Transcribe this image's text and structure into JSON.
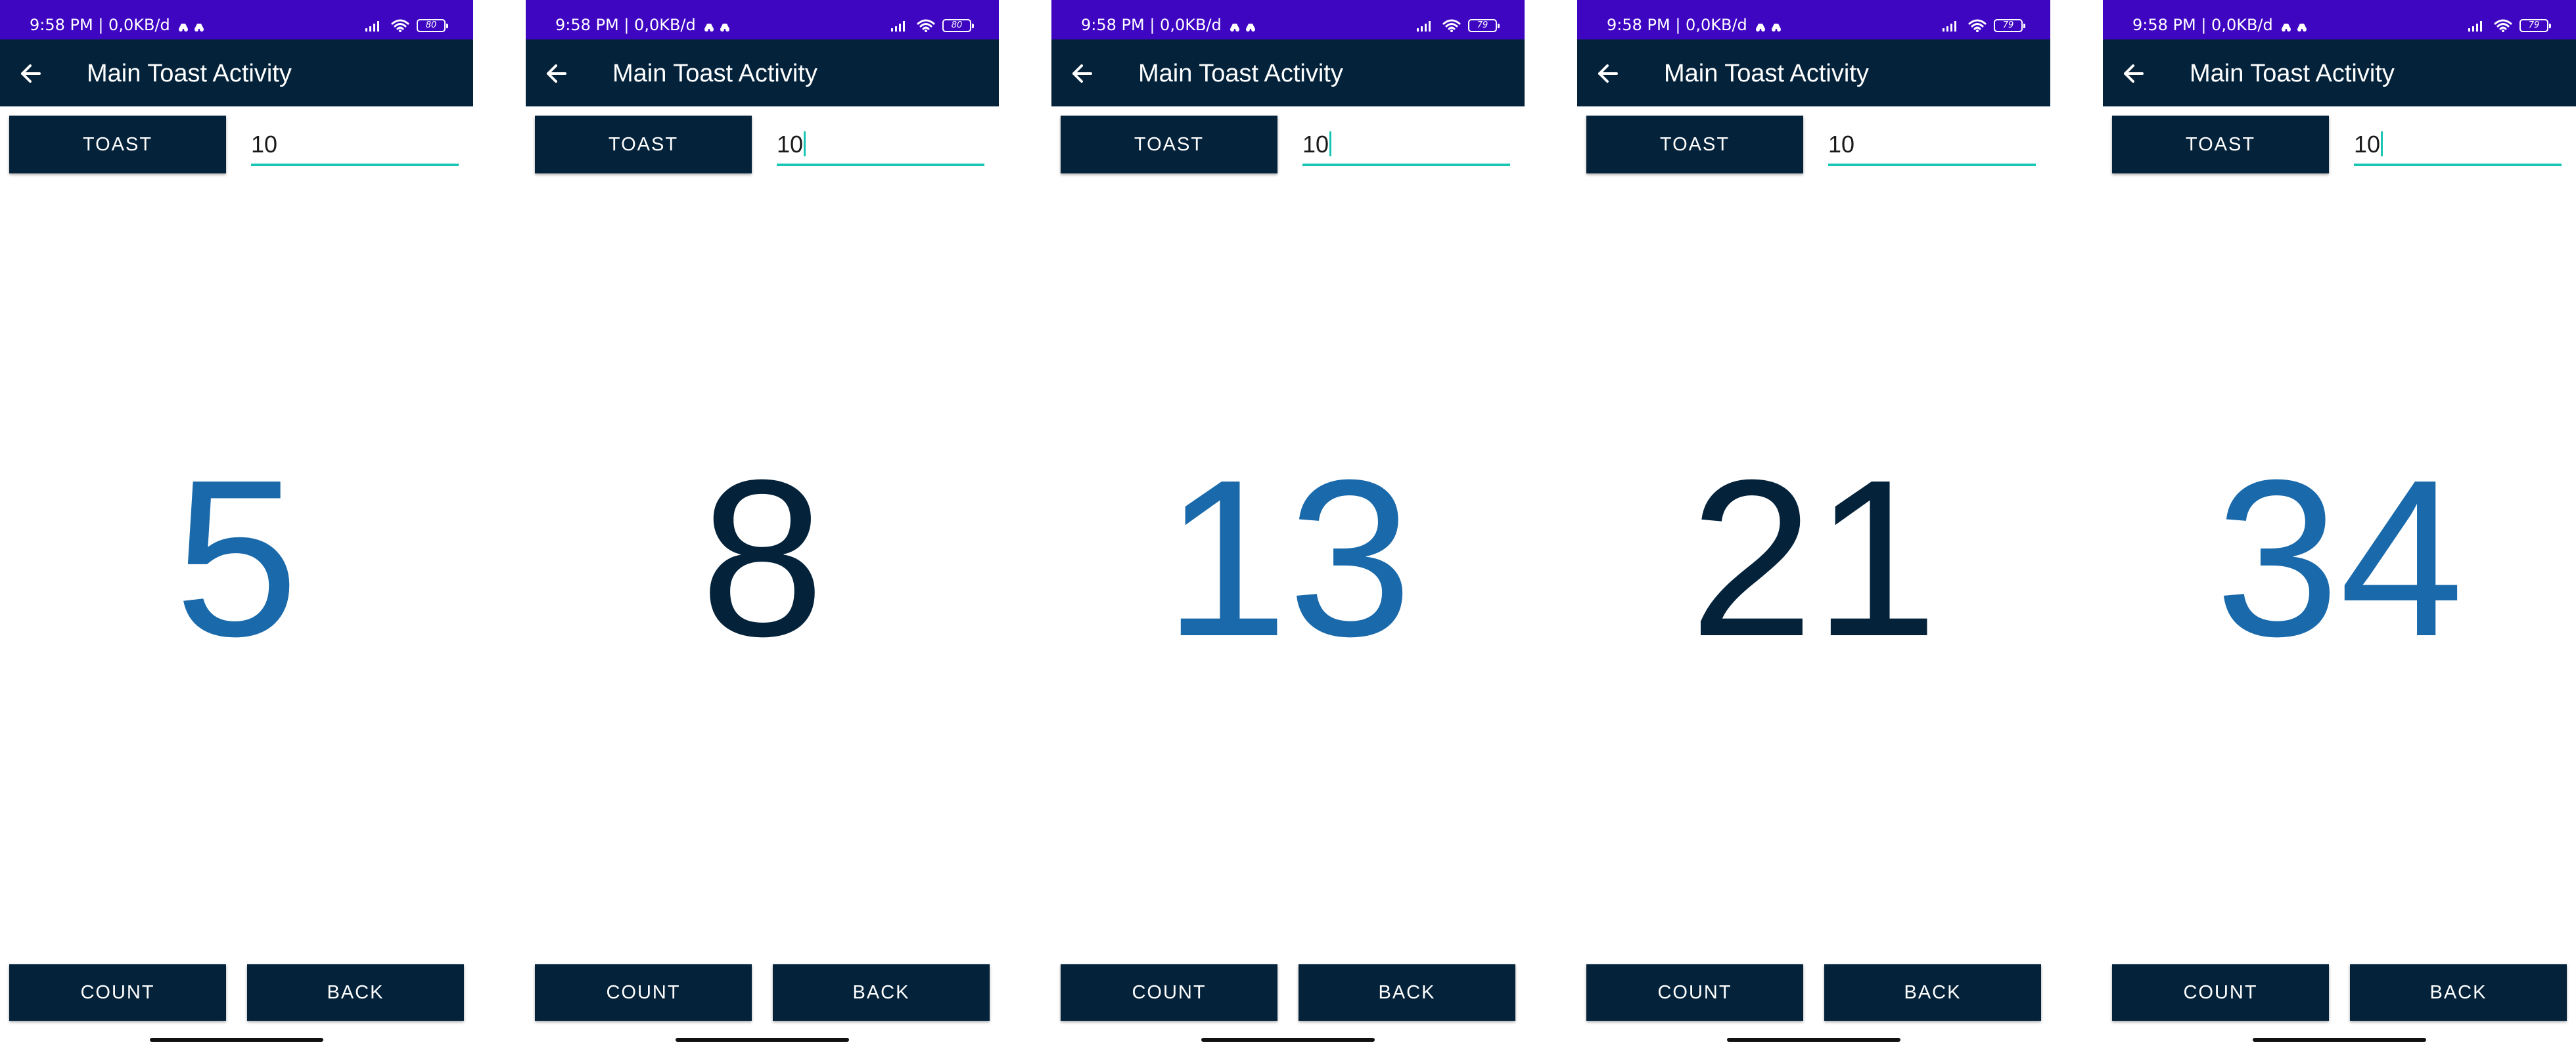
{
  "status_bar": {
    "time_info": "9:58 PM | 0,0KB/d",
    "battery_levels": [
      "80",
      "80",
      "79",
      "79",
      "79"
    ]
  },
  "toolbar": {
    "title": "Main Toast Activity"
  },
  "controls": {
    "toast_label": "TOAST",
    "input_value": "10",
    "count_label": "COUNT",
    "back_label": "BACK"
  },
  "screens": [
    {
      "count": "5",
      "input_focused": false,
      "count_color": "#1a6aab"
    },
    {
      "count": "8",
      "input_focused": true,
      "count_color": "#04233b"
    },
    {
      "count": "13",
      "input_focused": true,
      "count_color": "#1a6aab"
    },
    {
      "count": "21",
      "input_focused": false,
      "count_color": "#04233b"
    },
    {
      "count": "34",
      "input_focused": true,
      "count_color": "#1a6aab"
    }
  ],
  "colors": {
    "status_bar": "#3f06c2",
    "toolbar": "#04233b",
    "button": "#04233b",
    "input_underline": "#19c6b4",
    "count_blue": "#1a6aab",
    "count_dark": "#04233b"
  },
  "icons": {
    "toolbar": "back-arrow-icon",
    "status_left": "notification-icons",
    "status_right": [
      "signal-icon",
      "wifi-icon",
      "battery-icon"
    ]
  }
}
